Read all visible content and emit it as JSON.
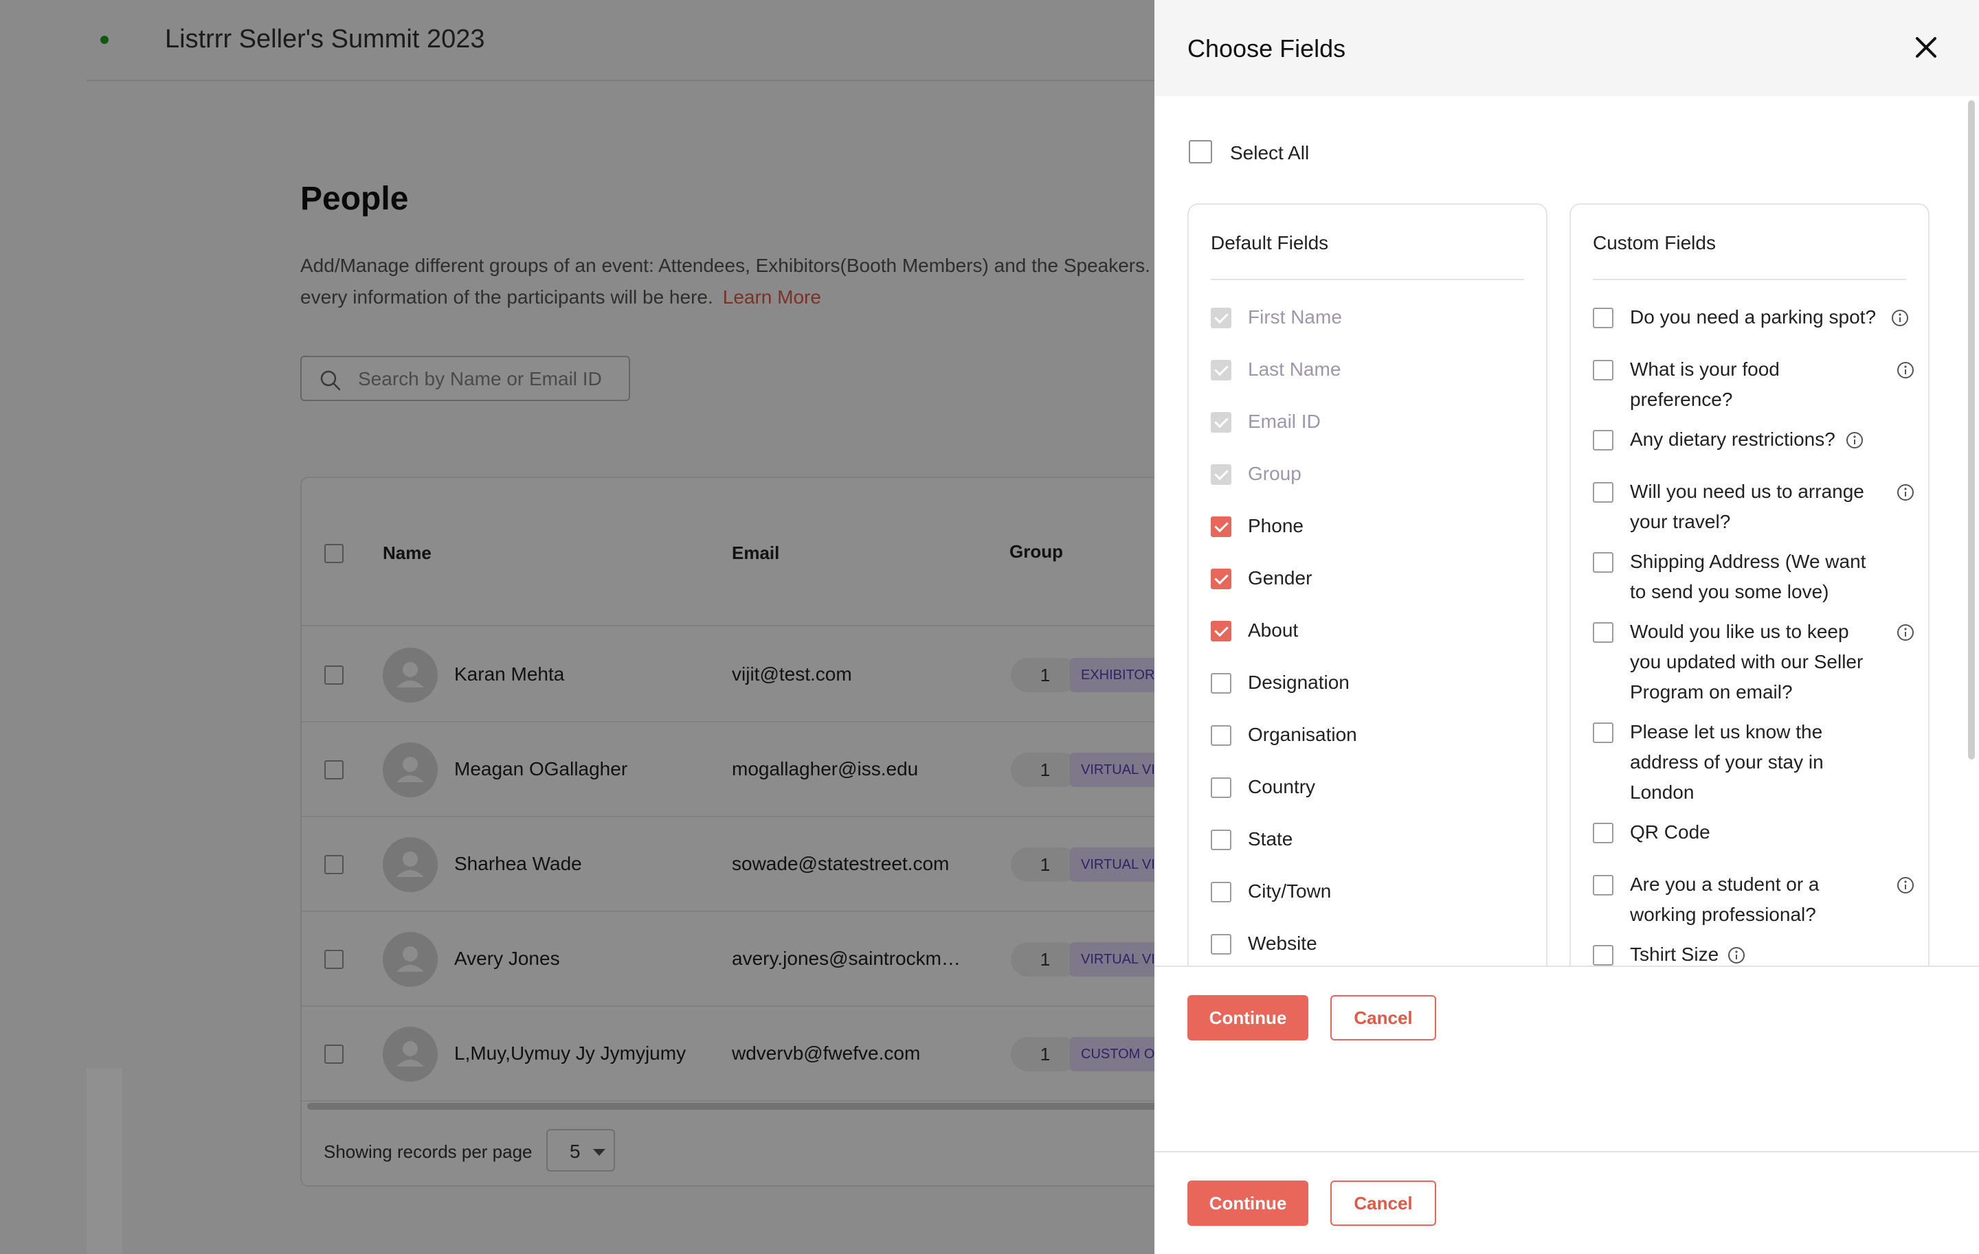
{
  "event": {
    "title": "Listrrr Seller's Summit 2023"
  },
  "people": {
    "title": "People",
    "description": "Add/Manage different groups of an event: Attendees, Exhibitors(Booth Members) and the Speakers.",
    "description2": "every information of the participants will be here.",
    "learn_more": "Learn More",
    "search_placeholder": "Search by Name or Email ID",
    "columns": {
      "name": "Name",
      "email": "Email",
      "group": "Group"
    },
    "rows": [
      {
        "name": "Karan Mehta",
        "email": "vijit@test.com",
        "count": "1",
        "tag": "EXHIBITOR"
      },
      {
        "name": "Meagan OGallagher",
        "email": "mogallagher@iss.edu",
        "count": "1",
        "tag": "VIRTUAL VI"
      },
      {
        "name": "Sharhea Wade",
        "email": "sowade@statestreet.com",
        "count": "1",
        "tag": "VIRTUAL VI"
      },
      {
        "name": "Avery Jones",
        "email": "avery.jones@saintrockm…",
        "count": "1",
        "tag": "VIRTUAL VI"
      },
      {
        "name": "L,Muy,Uymuy Jy Jymyjumy",
        "email": "wdvervb@fwefve.com",
        "count": "1",
        "tag": "CUSTOM O"
      }
    ],
    "per_page_label": "Showing records per page",
    "per_page_value": "5"
  },
  "drawer": {
    "title": "Choose Fields",
    "select_all": "Select All",
    "default_title": "Default Fields",
    "custom_title": "Custom Fields",
    "default_fields": [
      {
        "label": "First Name",
        "state": "disabled"
      },
      {
        "label": "Last Name",
        "state": "disabled"
      },
      {
        "label": "Email ID",
        "state": "disabled"
      },
      {
        "label": "Group",
        "state": "disabled"
      },
      {
        "label": "Phone",
        "state": "checked"
      },
      {
        "label": "Gender",
        "state": "checked"
      },
      {
        "label": "About",
        "state": "checked"
      },
      {
        "label": "Designation",
        "state": "unchecked"
      },
      {
        "label": "Organisation",
        "state": "unchecked"
      },
      {
        "label": "Country",
        "state": "unchecked"
      },
      {
        "label": "State",
        "state": "unchecked"
      },
      {
        "label": "City/Town",
        "state": "unchecked"
      },
      {
        "label": "Website",
        "state": "unchecked"
      }
    ],
    "custom_fields": [
      {
        "line1": "Do you need a parking spot?",
        "line2": "",
        "line3": "",
        "info": "inline"
      },
      {
        "line1": "What is your food",
        "line2": "preference?",
        "line3": "",
        "info": "right"
      },
      {
        "line1": "Any dietary restrictions?",
        "line2": "",
        "line3": "",
        "info": "inline"
      },
      {
        "line1": "Will you need us to arrange",
        "line2": "your travel?",
        "line3": "",
        "info": "right"
      },
      {
        "line1": "Shipping Address (We want",
        "line2": "to send you some love)",
        "line3": "",
        "info": "none"
      },
      {
        "line1": "Would you like us to keep",
        "line2": "you updated with our Seller",
        "line3": "Program on email?",
        "info": "right"
      },
      {
        "line1": "Please let us know the",
        "line2": "address of your stay in",
        "line3": "London",
        "info": "none"
      },
      {
        "line1": "QR Code",
        "line2": "",
        "line3": "",
        "info": "none"
      },
      {
        "line1": "Are you a student or a",
        "line2": "working professional?",
        "line3": "",
        "info": "right"
      },
      {
        "line1": "Tshirt Size",
        "line2": "",
        "line3": "",
        "info": "inline"
      }
    ],
    "continue": "Continue",
    "cancel": "Cancel"
  }
}
